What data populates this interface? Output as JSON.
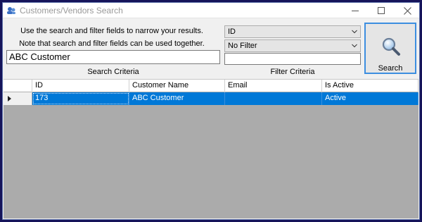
{
  "window": {
    "title": "Customers/Vendors Search"
  },
  "info": {
    "line1": "Use the search and filter fields to narrow your results.",
    "line2": "Note that search and filter fields can be used together."
  },
  "search": {
    "value": "ABC Customer",
    "label": "Search Criteria"
  },
  "filter": {
    "field_selected": "ID",
    "mode_selected": "No Filter",
    "value": "",
    "label": "Filter Criteria"
  },
  "search_button": {
    "label": "Search",
    "icon": "magnifier-icon"
  },
  "grid": {
    "columns": [
      "ID",
      "Customer Name",
      "Email",
      "Is Active"
    ],
    "rows": [
      {
        "id": "173",
        "name": "ABC Customer",
        "email": "",
        "active": "Active"
      }
    ]
  },
  "colors": {
    "selection": "#0078d7",
    "grid_background": "#ababab",
    "focus_border": "#3c8ee0"
  }
}
